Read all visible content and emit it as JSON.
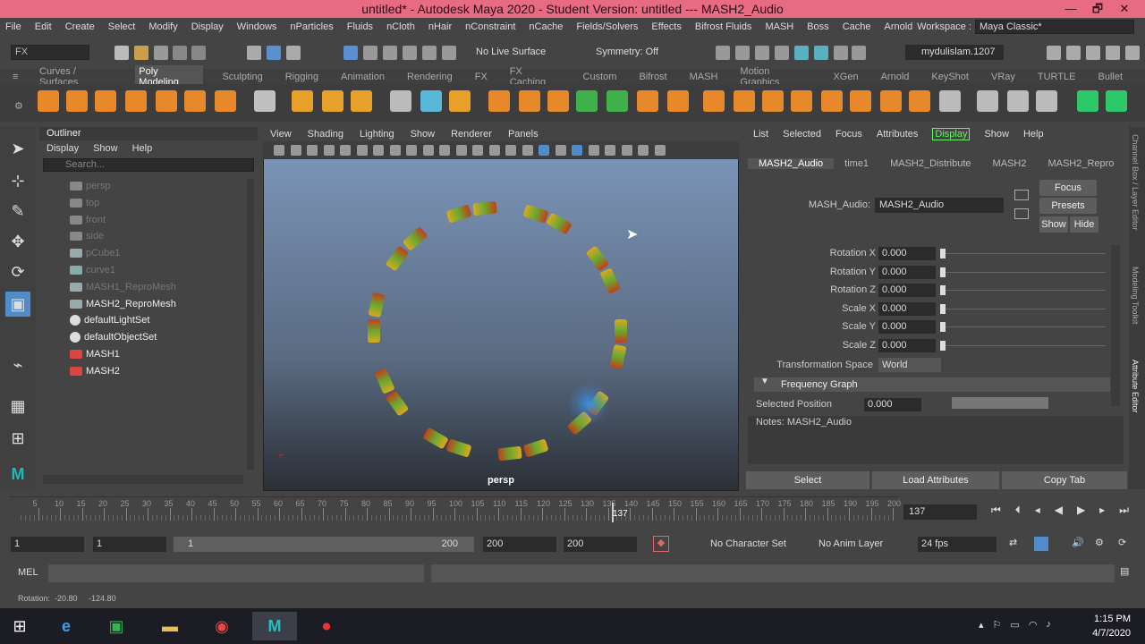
{
  "window": {
    "title": "untitled* - Autodesk Maya 2020 - Student Version: untitled    ---   MASH2_Audio",
    "minimize": "—",
    "maximize": "🗗",
    "close": "✕"
  },
  "menubar": [
    "File",
    "Edit",
    "Create",
    "Select",
    "Modify",
    "Display",
    "Windows",
    "nParticles",
    "Fluids",
    "nCloth",
    "nHair",
    "nConstraint",
    "nCache",
    "Fields/Solvers",
    "Effects",
    "Bifrost Fluids",
    "MASH",
    "Boss",
    "Cache",
    "Arnold"
  ],
  "workspace": {
    "label": "Workspace :",
    "value": "Maya Classic*"
  },
  "statusline": {
    "menuset": "FX",
    "live_surface": "No Live Surface",
    "symmetry": "Symmetry: Off",
    "user": "mydulislam.1207"
  },
  "shelf_tabs": [
    "Curves / Surfaces",
    "Poly Modeling",
    "Sculpting",
    "Rigging",
    "Animation",
    "Rendering",
    "FX",
    "FX Caching",
    "Custom",
    "Bifrost",
    "MASH",
    "Motion Graphics",
    "XGen",
    "Arnold",
    "KeyShot",
    "VRay",
    "TURTLE",
    "Bullet"
  ],
  "shelf_active": "Poly Modeling",
  "outliner": {
    "title": "Outliner",
    "menu": [
      "Display",
      "Show",
      "Help"
    ],
    "search_placeholder": "Search...",
    "items": [
      {
        "name": "persp",
        "dim": true,
        "icon": "camera-icon"
      },
      {
        "name": "top",
        "dim": true,
        "icon": "camera-icon"
      },
      {
        "name": "front",
        "dim": true,
        "icon": "camera-icon"
      },
      {
        "name": "side",
        "dim": true,
        "icon": "camera-icon"
      },
      {
        "name": "pCube1",
        "dim": true,
        "icon": "mesh-icon"
      },
      {
        "name": "curve1",
        "dim": true,
        "icon": "curve-icon"
      },
      {
        "name": "MASH1_ReproMesh",
        "dim": true,
        "icon": "mesh-icon"
      },
      {
        "name": "MASH2_ReproMesh",
        "dim": false,
        "icon": "mesh-icon"
      },
      {
        "name": "defaultLightSet",
        "dim": false,
        "icon": "set-icon"
      },
      {
        "name": "defaultObjectSet",
        "dim": false,
        "icon": "set-icon"
      },
      {
        "name": "MASH1",
        "dim": false,
        "icon": "mash-icon"
      },
      {
        "name": "MASH2",
        "dim": false,
        "icon": "mash-icon"
      }
    ]
  },
  "viewport": {
    "menu": [
      "View",
      "Shading",
      "Lighting",
      "Show",
      "Renderer",
      "Panels"
    ],
    "camera": "persp"
  },
  "attr_editor": {
    "menu": [
      "List",
      "Selected",
      "Focus",
      "Attributes",
      "Display",
      "Show",
      "Help"
    ],
    "tabs": [
      "MASH2_Audio",
      "time1",
      "MASH2_Distribute",
      "MASH2",
      "MASH2_Repro"
    ],
    "node_label": "MASH_Audio:",
    "node_value": "MASH2_Audio",
    "buttons": {
      "focus": "Focus",
      "presets": "Presets",
      "show": "Show",
      "hide": "Hide"
    },
    "attrs": [
      {
        "label": "Rotation X",
        "value": "0.000"
      },
      {
        "label": "Rotation Y",
        "value": "0.000"
      },
      {
        "label": "Rotation Z",
        "value": "0.000"
      },
      {
        "label": "Scale X",
        "value": "0.000"
      },
      {
        "label": "Scale Y",
        "value": "0.000"
      },
      {
        "label": "Scale Z",
        "value": "0.000"
      }
    ],
    "transformation_space": {
      "label": "Transformation Space",
      "value": "World"
    },
    "frequency_graph": "Frequency Graph",
    "selected_position": {
      "label": "Selected Position",
      "value": "0.000"
    },
    "notes": "Notes:  MASH2_Audio",
    "bottom": {
      "select": "Select",
      "load": "Load Attributes",
      "copy": "Copy Tab"
    }
  },
  "side_tabs": [
    "Channel Box / Layer Editor",
    "Modeling Toolkit",
    "Attribute Editor"
  ],
  "timeline": {
    "ticks": [
      "5",
      "10",
      "15",
      "20",
      "25",
      "30",
      "35",
      "40",
      "45",
      "50",
      "55",
      "60",
      "65",
      "70",
      "75",
      "80",
      "85",
      "90",
      "95",
      "100",
      "105",
      "110",
      "115",
      "120",
      "125",
      "130",
      "135",
      "140",
      "145",
      "150",
      "155",
      "160",
      "165",
      "170",
      "175",
      "180",
      "185",
      "190",
      "195",
      "200"
    ],
    "current": "137",
    "current_field": "137"
  },
  "range": {
    "start": "1",
    "anim_start": "1",
    "slider_start": "1",
    "slider_end": "200",
    "end": "200",
    "anim_end": "200",
    "character": "No Character Set",
    "anim_layer": "No Anim Layer",
    "fps": "24 fps"
  },
  "cmd": {
    "label": "MEL"
  },
  "help": "Rotation:  -20.80     -124.80",
  "clock": {
    "time": "1:15 PM",
    "date": "4/7/2020"
  }
}
